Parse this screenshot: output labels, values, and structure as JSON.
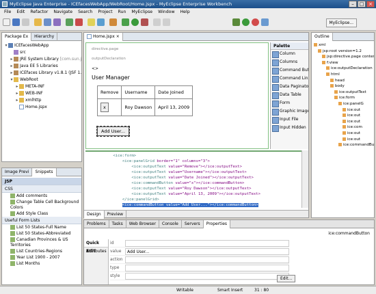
{
  "window": {
    "title": "MyEclipse Java Enterprise - ICEfacesWebApp/WebRoot/Home.jspx - MyEclipse Enterprise Workbench"
  },
  "menu": [
    "File",
    "Edit",
    "Refactor",
    "Navigate",
    "Search",
    "Project",
    "Run",
    "MyEclipse",
    "Window",
    "Help"
  ],
  "toolbar": {
    "perspective": "MyEclipse..."
  },
  "left_top": {
    "tabs": [
      "Package Ex",
      "Hierarchy"
    ],
    "tree": [
      {
        "label": "ICEfacesWebApp",
        "indent": 0,
        "icon": "proj",
        "tw": "▾"
      },
      {
        "label": "src",
        "indent": 1,
        "icon": "pkg",
        "tw": ""
      },
      {
        "label": "JRE System Library",
        "suffix": "[com.sun.java",
        "indent": 1,
        "icon": "jar",
        "tw": "▸"
      },
      {
        "label": "Java EE 5 Libraries",
        "indent": 1,
        "icon": "jar",
        "tw": "▸"
      },
      {
        "label": "ICEfaces Library v1.8.1 (JSF 1.2)",
        "indent": 1,
        "icon": "jar",
        "tw": "▸"
      },
      {
        "label": "WebRoot",
        "indent": 1,
        "icon": "fold",
        "tw": "▾"
      },
      {
        "label": "META-INF",
        "indent": 2,
        "icon": "fold",
        "tw": "▸"
      },
      {
        "label": "WEB-INF",
        "indent": 2,
        "icon": "fold",
        "tw": "▸"
      },
      {
        "label": "xmlhttp",
        "indent": 2,
        "icon": "fold",
        "tw": "▸"
      },
      {
        "label": "Home.jspx",
        "indent": 2,
        "icon": "file",
        "tw": ""
      }
    ]
  },
  "left_bottom": {
    "tabs": [
      "Image Previ",
      "Snippets"
    ],
    "category": "JSP",
    "sections": [
      {
        "title": "CSS",
        "items": [
          "Add comments",
          "Change Table Cell Background Colors",
          "Add Style Class"
        ]
      },
      {
        "title": "Useful Form Lists",
        "items": [
          "List 50 States-Full Name",
          "List 50 States-Abbreviated",
          "Canadian Provinces & US Territories",
          "List Countries-Regions",
          "Year List 1900 - 2007",
          "List Months"
        ]
      }
    ]
  },
  "editor": {
    "tab": "Home.jspx",
    "design": {
      "directive": "directive.page",
      "output_decl": "outputDeclaration",
      "tag_glyph": "<>",
      "heading": "User Manager",
      "table_headers": [
        "Remove",
        "Username",
        "Date Joined"
      ],
      "row": {
        "remove": "x",
        "username": "Roy Dawson",
        "date": "April 13, 2009"
      },
      "add_button": "Add User..."
    },
    "code": [
      {
        "indent": "            ",
        "tag": "<ice:form>",
        "rest": ""
      },
      {
        "indent": "                ",
        "tag": "<ice:panelGrid",
        "rest": " border=\"1\" columns=\"3\">"
      },
      {
        "indent": "                    ",
        "tag": "<ice:outputText",
        "rest": " value=\"Remove\"></ice:outputText>"
      },
      {
        "indent": "                    ",
        "tag": "<ice:outputText",
        "rest": " value=\"Username\"></ice:outputText>"
      },
      {
        "indent": "                    ",
        "tag": "<ice:outputText",
        "rest": " value=\"Date Joined\"></ice:outputText>"
      },
      {
        "indent": "                    ",
        "tag": "<ice:commandButton",
        "rest": " value=\"x\"></ice:commandButton>"
      },
      {
        "indent": "                    ",
        "tag": "<ice:outputText",
        "rest": " value=\"Roy Dawson\"></ice:outputText>"
      },
      {
        "indent": "                    ",
        "tag": "<ice:outputText",
        "rest": " value=\"April 13, 2009\"></ice:outputText>"
      },
      {
        "indent": "                ",
        "tag": "</ice:panelGrid>",
        "rest": ""
      }
    ],
    "code_highlight": "<ice:commandButton value=\"Add User...\"></ice:commandButton>",
    "bottom_tabs": [
      "Design",
      "Preview"
    ]
  },
  "palette": {
    "title": "Palette",
    "items": [
      "Column",
      "Columns",
      "Command Button",
      "Command Link",
      "Data Paginator",
      "Data Table",
      "Form",
      "Graphic Image",
      "Input File",
      "Input Hidden"
    ]
  },
  "outline": {
    "title": "Outline",
    "items": [
      {
        "label": "xml",
        "indent": 0
      },
      {
        "label": "jsp:root version=1.2",
        "indent": 1
      },
      {
        "label": "jsp:directive.page content",
        "indent": 2
      },
      {
        "label": "f:view",
        "indent": 2
      },
      {
        "label": "ice:outputDeclaration",
        "indent": 3
      },
      {
        "label": "html",
        "indent": 3
      },
      {
        "label": "head",
        "indent": 4
      },
      {
        "label": "body",
        "indent": 4
      },
      {
        "label": "ice:outputText",
        "indent": 5
      },
      {
        "label": "ice:form",
        "indent": 5
      },
      {
        "label": "ice:panelG",
        "indent": 6
      },
      {
        "label": "ice:out",
        "indent": 7
      },
      {
        "label": "ice:out",
        "indent": 7
      },
      {
        "label": "ice:out",
        "indent": 7
      },
      {
        "label": "ice:com",
        "indent": 7
      },
      {
        "label": "ice:out",
        "indent": 7
      },
      {
        "label": "ice:out",
        "indent": 7
      },
      {
        "label": "ice:commandButton",
        "indent": 6
      }
    ]
  },
  "bottom": {
    "tabs": [
      "Problems",
      "Tasks",
      "Web Browser",
      "Console",
      "Servers",
      "Properties"
    ],
    "context": "ice:commandButton",
    "side_tabs": [
      "Quick Edit",
      "Attributes"
    ],
    "props": [
      {
        "key": "id",
        "value": ""
      },
      {
        "key": "value",
        "value": "Add User..."
      },
      {
        "key": "action",
        "value": ""
      },
      {
        "key": "type",
        "value": ""
      },
      {
        "key": "style",
        "value": ""
      }
    ],
    "edit_button": "Edit..."
  },
  "status": {
    "writable": "Writable",
    "insert": "Smart Insert",
    "position": "31 : 80"
  }
}
